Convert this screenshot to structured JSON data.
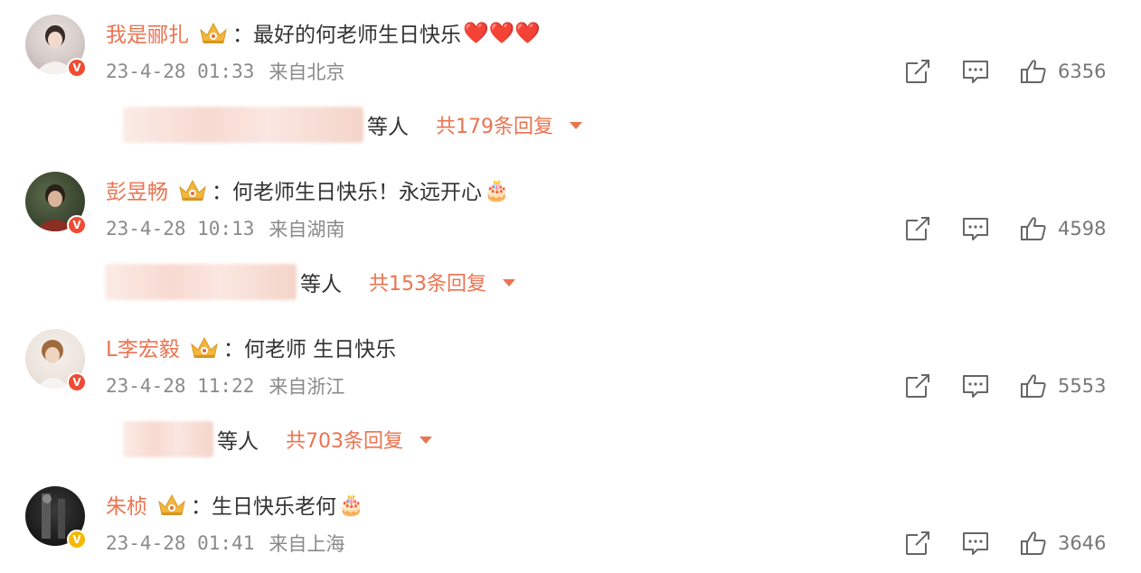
{
  "comments": [
    {
      "username": "我是郦扎",
      "colon": "：",
      "text": "最好的何老师生日快乐",
      "emoji": "❤️❤️❤️",
      "date": "23-4-28 01:33",
      "source": "来自北京",
      "likes": "6356",
      "reply_etc": "等人",
      "reply_count": "共179条回复",
      "badge_type": "red-v",
      "badge_label": "V"
    },
    {
      "username": "彭昱畅",
      "colon": "：",
      "text": "何老师生日快乐！永远开心",
      "emoji": "🎂",
      "date": "23-4-28 10:13",
      "source": "来自湖南",
      "likes": "4598",
      "reply_etc": "等人",
      "reply_count": "共153条回复",
      "badge_type": "red-v",
      "badge_label": "V"
    },
    {
      "username": "L李宏毅",
      "colon": "：",
      "text": "何老师 生日快乐",
      "emoji": "",
      "date": "23-4-28 11:22",
      "source": "来自浙江",
      "likes": "5553",
      "reply_etc": "等人",
      "reply_count": "共703条回复",
      "badge_type": "red-v",
      "badge_label": "V"
    },
    {
      "username": "朱桢",
      "colon": "：",
      "text": "生日快乐老何",
      "emoji": "🎂",
      "date": "23-4-28 01:41",
      "source": "来自上海",
      "likes": "3646",
      "badge_type": "gold-v",
      "badge_label": "V"
    }
  ],
  "colors": {
    "username": "#eb7350",
    "reply_link": "#eb7350",
    "meta_text": "#8a8a8a",
    "badge_red": "#f04b33",
    "badge_gold": "#f5b800",
    "crown": "#f3b63c"
  },
  "icons": {
    "crown": "crown-icon",
    "share": "share-icon",
    "comment": "comment-icon",
    "like": "thumbs-up-icon",
    "expand": "chevron-down-icon"
  }
}
